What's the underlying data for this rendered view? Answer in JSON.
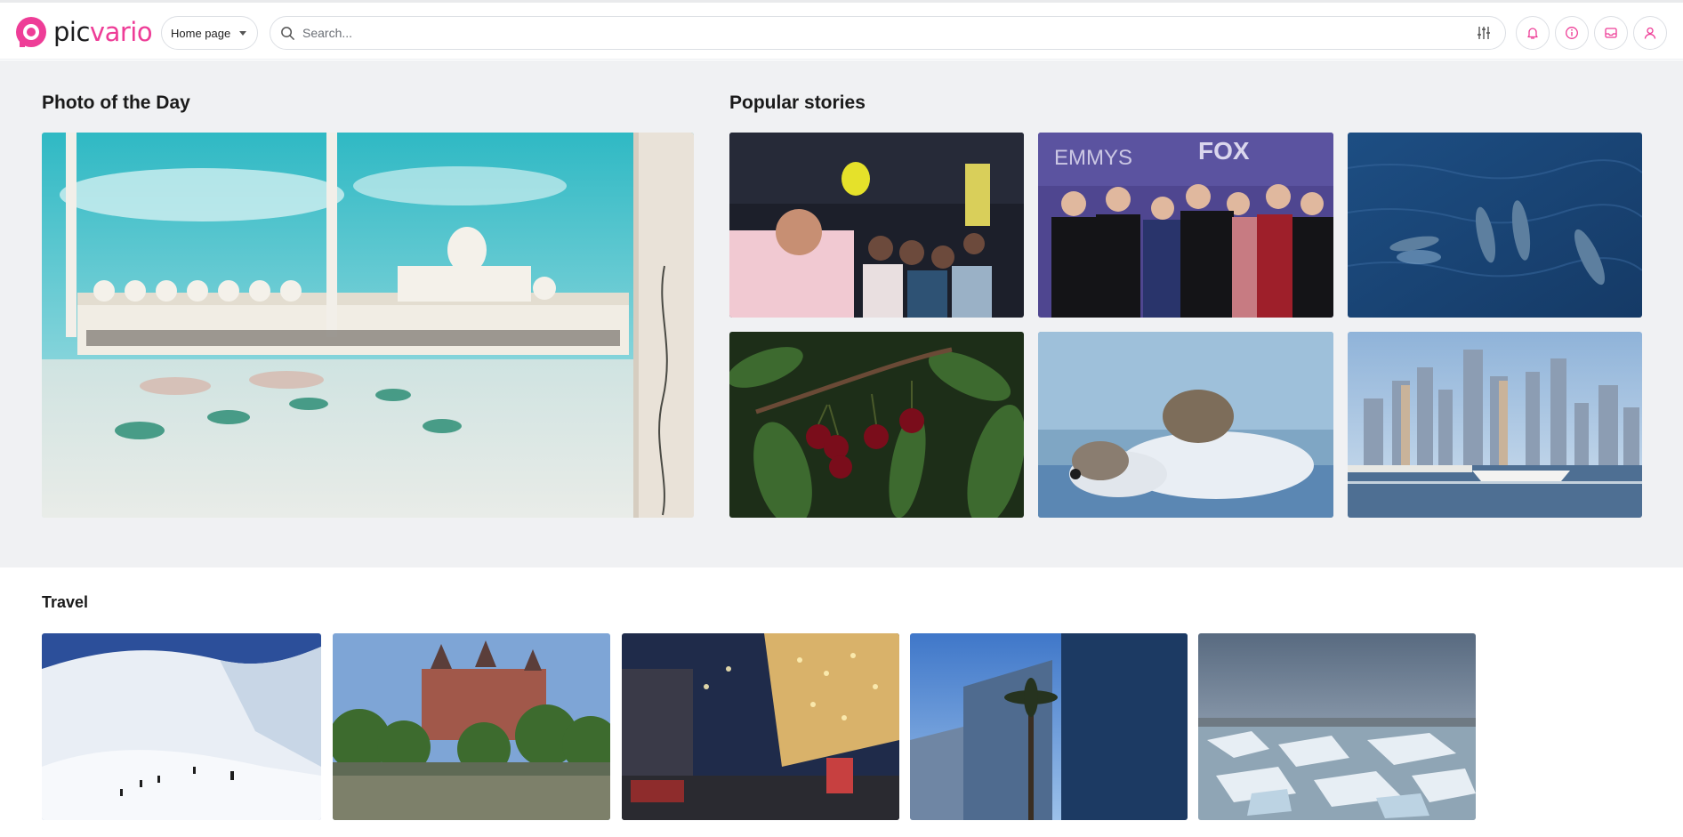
{
  "brand": {
    "name_part1": "pic",
    "name_part2": "vario",
    "accent": "#ee3d97"
  },
  "nav": {
    "selected": "Home page"
  },
  "search": {
    "placeholder": "Search..."
  },
  "header_icons": [
    "filter-sliders-icon",
    "bell-icon",
    "info-icon",
    "inbox-icon",
    "user-icon"
  ],
  "photo_of_day": {
    "title": "Photo of the Day"
  },
  "popular": {
    "title": "Popular stories"
  },
  "travel": {
    "title": "Travel"
  },
  "colors": {
    "hero_bg": "#f0f1f3",
    "border": "#dcdfe4"
  }
}
